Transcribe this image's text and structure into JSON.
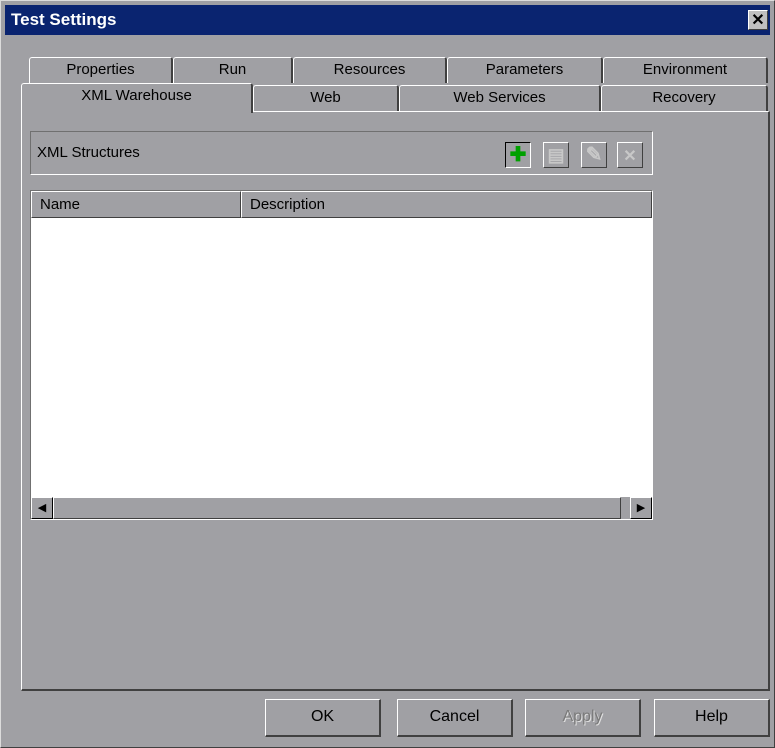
{
  "window": {
    "title": "Test Settings",
    "close_glyph": "✕"
  },
  "tabs": {
    "row1": [
      {
        "label": "Properties"
      },
      {
        "label": "Run"
      },
      {
        "label": "Resources"
      },
      {
        "label": "Parameters"
      },
      {
        "label": "Environment"
      }
    ],
    "row2": [
      {
        "label": "XML Warehouse",
        "active": true
      },
      {
        "label": "Web"
      },
      {
        "label": "Web Services"
      },
      {
        "label": "Recovery"
      }
    ]
  },
  "xml_panel": {
    "group_label": "XML Structures",
    "toolbar": [
      {
        "icon": "add-icon",
        "glyph": "✚",
        "color": "#00a000",
        "enabled": true
      },
      {
        "icon": "copy-icon",
        "glyph": "▤",
        "color": "#c8c8c8",
        "enabled": false
      },
      {
        "icon": "edit-icon",
        "glyph": "✎",
        "color": "#c8c8c8",
        "enabled": false
      },
      {
        "icon": "delete-icon",
        "glyph": "✕",
        "color": "#c8c8c8",
        "enabled": false
      }
    ],
    "columns": [
      "Name",
      "Description"
    ],
    "rows": []
  },
  "buttons": {
    "ok": "OK",
    "cancel": "Cancel",
    "apply": "Apply",
    "help": "Help"
  },
  "colors": {
    "titlebar": "#0a2470",
    "face": "#a0a0a4"
  }
}
